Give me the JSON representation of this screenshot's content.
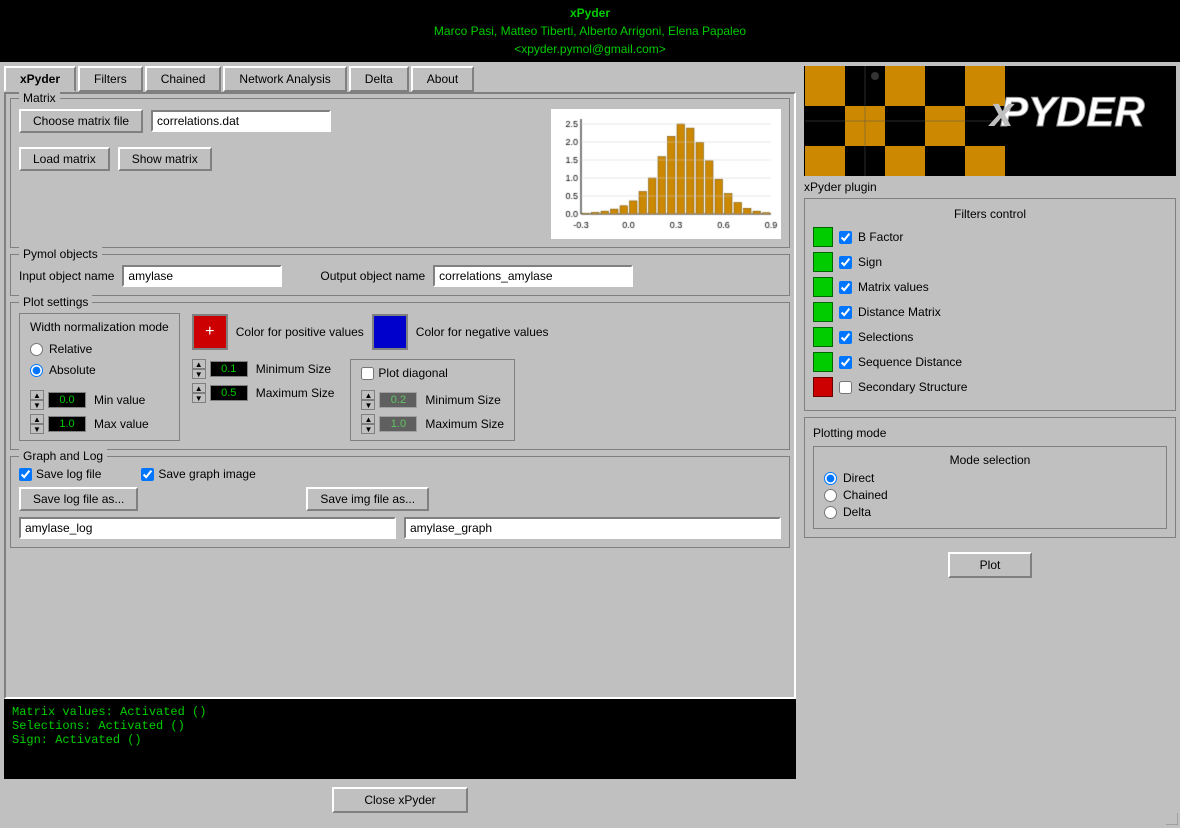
{
  "header": {
    "title": "xPyder",
    "authors": "Marco Pasi, Matteo Tiberti, Alberto Arrigoni, Elena Papaleo",
    "email": "<xpyder.pymol@gmail.com>"
  },
  "tabs": [
    {
      "label": "xPyder",
      "active": true
    },
    {
      "label": "Filters",
      "active": false
    },
    {
      "label": "Chained",
      "active": false
    },
    {
      "label": "Network Analysis",
      "active": false
    },
    {
      "label": "Delta",
      "active": false
    },
    {
      "label": "About",
      "active": false
    }
  ],
  "matrix": {
    "group_title": "Matrix",
    "choose_btn": "Choose matrix file",
    "file_name": "correlations.dat",
    "load_btn": "Load matrix",
    "show_btn": "Show matrix"
  },
  "pymol_objects": {
    "group_title": "Pymol objects",
    "input_label": "Input object name",
    "input_value": "amylase",
    "output_label": "Output object name",
    "output_value": "correlations_amylase"
  },
  "plot_settings": {
    "group_title": "Plot settings",
    "width_norm_title": "Width normalization mode",
    "relative_label": "Relative",
    "absolute_label": "Absolute",
    "color_positive_label": "Color for positive values",
    "color_negative_label": "Color for negative values",
    "min_value_label": "Min value",
    "max_value_label": "Max value",
    "min_value": "0.0",
    "max_value": "1.0",
    "minimum_size_label": "Minimum Size",
    "maximum_size_label": "Maximum Size",
    "min_size_val": "0.1",
    "max_size_val": "0.5",
    "plot_diagonal_label": "Plot diagonal",
    "diag_min_size": "0.2",
    "diag_max_size": "1.0"
  },
  "graph_log": {
    "group_title": "Graph and Log",
    "save_log_label": "Save log file",
    "save_graph_label": "Save graph image",
    "save_log_btn": "Save log file as...",
    "save_img_btn": "Save img file as...",
    "log_filename": "amylase_log",
    "graph_filename": "amylase_graph"
  },
  "console": {
    "lines": [
      "Matrix values: Activated ()",
      "Selections: Activated ()",
      "Sign: Activated ()"
    ]
  },
  "close_btn": "Close xPyder",
  "right_panel": {
    "plugin_label": "xPyder plugin",
    "filters_control_title": "Filters control",
    "filters": [
      {
        "label": "B Factor",
        "color": "green",
        "checked": true
      },
      {
        "label": "Sign",
        "color": "green",
        "checked": true
      },
      {
        "label": "Matrix values",
        "color": "green",
        "checked": true
      },
      {
        "label": "Distance Matrix",
        "color": "green",
        "checked": true
      },
      {
        "label": "Selections",
        "color": "green",
        "checked": true
      },
      {
        "label": "Sequence Distance",
        "color": "green",
        "checked": true
      },
      {
        "label": "Secondary Structure",
        "color": "red",
        "checked": false
      }
    ],
    "plotting_mode_title": "Plotting mode",
    "mode_selection_title": "Mode selection",
    "modes": [
      {
        "label": "Direct",
        "selected": true
      },
      {
        "label": "Chained",
        "selected": false
      },
      {
        "label": "Delta",
        "selected": false
      }
    ],
    "plot_btn": "Plot"
  }
}
